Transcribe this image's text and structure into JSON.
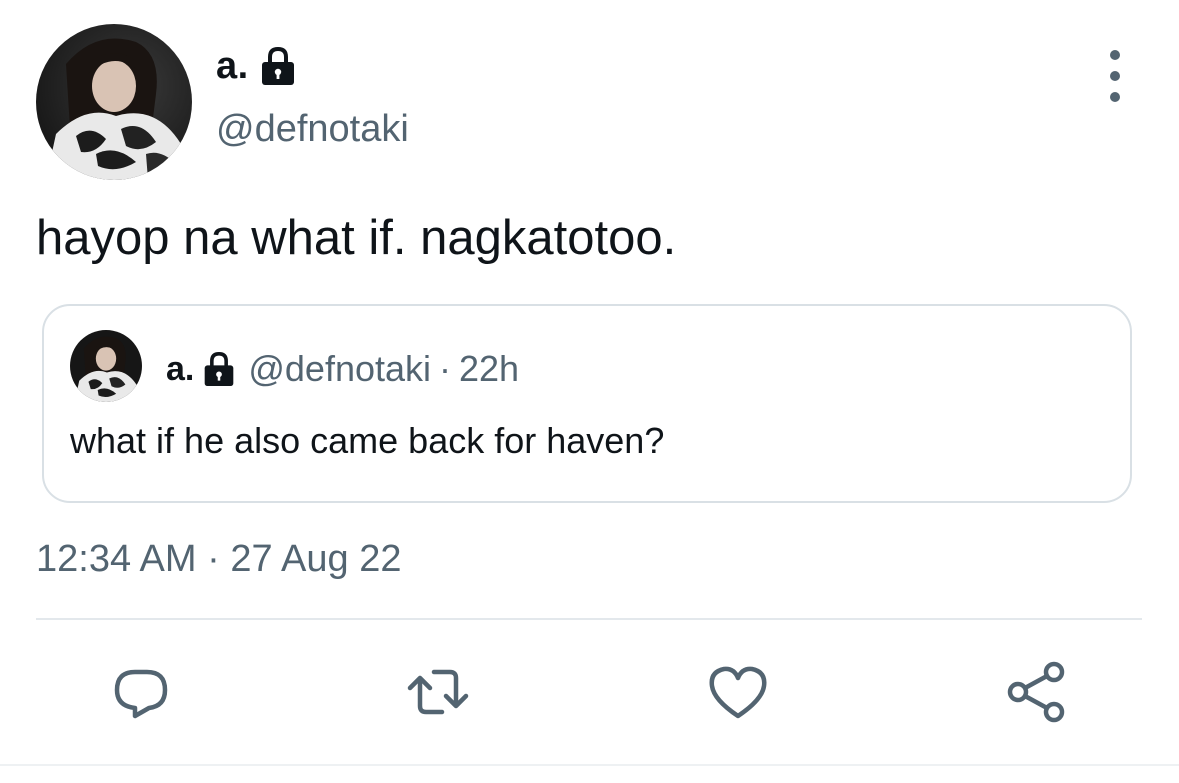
{
  "tweet": {
    "author": {
      "display_name": "a.",
      "handle": "@defnotaki",
      "protected_icon": "lock-icon",
      "avatar": "profile-photo"
    },
    "text": "hayop na what if. nagkatotoo.",
    "timestamp": "12:34 AM · 27 Aug 22",
    "more_icon": "more-vertical-icon"
  },
  "quoted_tweet": {
    "author": {
      "display_name": "a.",
      "handle": "@defnotaki",
      "protected_icon": "lock-icon"
    },
    "separator": "·",
    "time": "22h",
    "text": "what if he also came back for haven?"
  },
  "actions": [
    {
      "name": "reply",
      "icon": "reply-icon"
    },
    {
      "name": "retweet",
      "icon": "retweet-icon"
    },
    {
      "name": "like",
      "icon": "heart-icon"
    },
    {
      "name": "share",
      "icon": "share-icon"
    }
  ],
  "colors": {
    "text_primary": "#0f1419",
    "text_secondary": "#536471",
    "border": "#d9e0e5",
    "icon": "#536471"
  }
}
